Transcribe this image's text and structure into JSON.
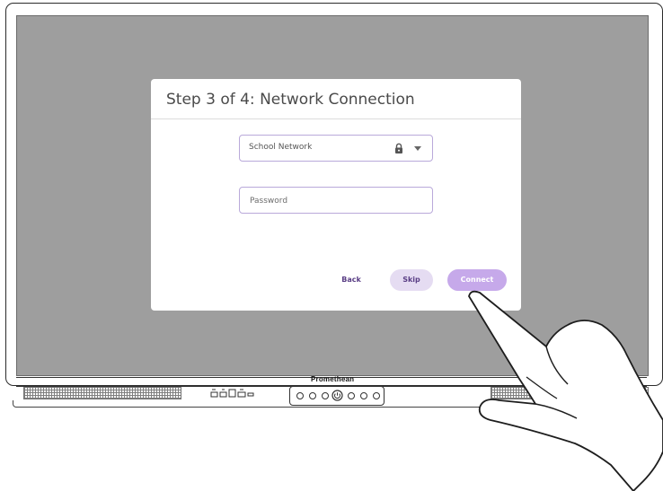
{
  "dialog": {
    "title": "Step 3 of 4: Network Connection",
    "network_select": {
      "value": "School Network",
      "icons": [
        "lock-icon",
        "chevron-down-icon"
      ]
    },
    "password_field": {
      "placeholder": "Password",
      "value": ""
    },
    "buttons": {
      "back": "Back",
      "skip": "Skip",
      "connect": "Connect"
    }
  },
  "device": {
    "brand": "Promethean"
  },
  "colors": {
    "screen_background": "#9e9e9e",
    "accent_purple": "#c6a9ea",
    "skip_button_bg": "#e5dcf2",
    "button_text": "#5a3e85",
    "field_border": "#b9a9da"
  }
}
